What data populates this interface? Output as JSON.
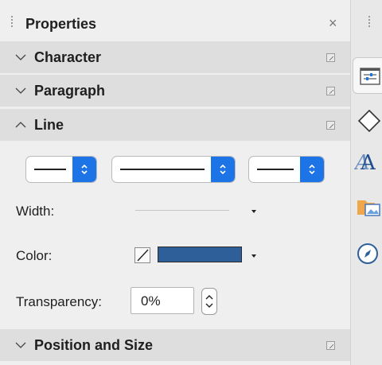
{
  "panel": {
    "title": "Properties",
    "close_symbol": "×"
  },
  "sections": {
    "character": "Character",
    "paragraph": "Paragraph",
    "line": "Line",
    "position_size": "Position and Size"
  },
  "line": {
    "width_label": "Width:",
    "color_label": "Color:",
    "transparency_label": "Transparency:",
    "transparency_value": "0%",
    "line_color": "#2f5f99"
  },
  "icons": {
    "collapse": "chevron-down-icon",
    "expand": "chevron-up-icon",
    "more_options": "more-options-icon",
    "properties_tab": "properties-icon",
    "styles_tab": "styles-icon",
    "gallery_tab": "gallery-icon",
    "navigator_tab": "navigator-icon",
    "shapes_tab": "shapes-icon"
  },
  "colors": {
    "accent": "#1d74e6",
    "section_bg": "#dedede",
    "panel_bg": "#efefef"
  }
}
